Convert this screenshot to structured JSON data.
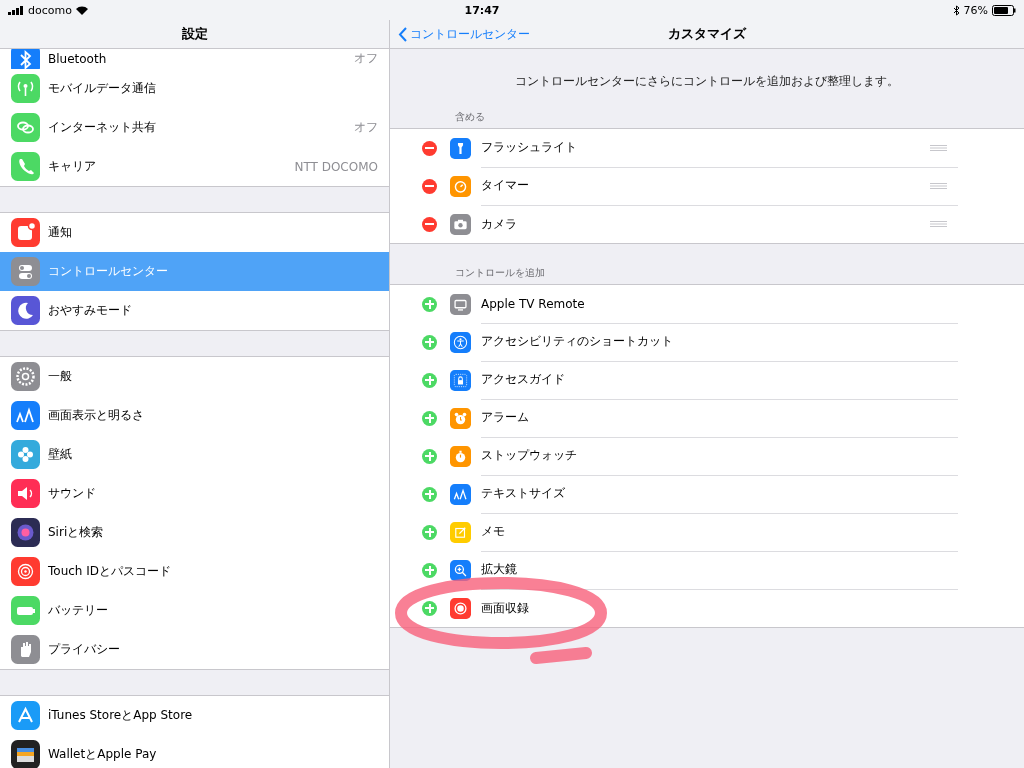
{
  "status_bar": {
    "carrier": "docomo",
    "time": "17:47",
    "battery": "76%"
  },
  "sidebar": {
    "title": "設定",
    "groups": [
      [
        {
          "label": "Bluetooth",
          "value": "オフ",
          "color": "#157efb",
          "selected": false
        },
        {
          "label": "モバイルデータ通信",
          "color": "#4cd964",
          "selected": false
        },
        {
          "label": "インターネット共有",
          "value": "オフ",
          "color": "#4cd964",
          "selected": false
        },
        {
          "label": "キャリア",
          "value": "NTT DOCOMO",
          "color": "#4cd964",
          "selected": false
        }
      ],
      [
        {
          "label": "通知",
          "color": "#ff3b30",
          "selected": false
        },
        {
          "label": "コントロールセンター",
          "color": "#8e8e93",
          "selected": true
        },
        {
          "label": "おやすみモード",
          "color": "#5856d6",
          "selected": false
        }
      ],
      [
        {
          "label": "一般",
          "color": "#8e8e93",
          "selected": false
        },
        {
          "label": "画面表示と明るさ",
          "color": "#157efb",
          "selected": false
        },
        {
          "label": "壁紙",
          "color": "#34aadc",
          "selected": false
        },
        {
          "label": "サウンド",
          "color": "#ff2d55",
          "selected": false
        },
        {
          "label": "Siriと検索",
          "color": "#2c2c54",
          "selected": false
        },
        {
          "label": "Touch IDとパスコード",
          "color": "#ff3b30",
          "selected": false
        },
        {
          "label": "バッテリー",
          "color": "#4cd964",
          "selected": false
        },
        {
          "label": "プライバシー",
          "color": "#8e8e93",
          "selected": false
        }
      ],
      [
        {
          "label": "iTunes StoreとApp Store",
          "color": "#1a9bf7",
          "selected": false
        },
        {
          "label": "WalletとApple Pay",
          "color": "#222222",
          "selected": false
        }
      ]
    ]
  },
  "detail": {
    "back": "コントロールセンター",
    "title": "カスタマイズ",
    "description": "コントロールセンターにさらにコントロールを追加および整理します。",
    "sections": [
      {
        "kind": "included",
        "header": "含める",
        "rows": [
          {
            "label": "フラッシュライト",
            "color": "#157efb"
          },
          {
            "label": "タイマー",
            "color": "#ff9500"
          },
          {
            "label": "カメラ",
            "color": "#8e8e93"
          }
        ]
      },
      {
        "kind": "available",
        "header": "コントロールを追加",
        "rows": [
          {
            "label": "Apple TV Remote",
            "color": "#8e8e93"
          },
          {
            "label": "アクセシビリティのショートカット",
            "color": "#157efb"
          },
          {
            "label": "アクセスガイド",
            "color": "#157efb"
          },
          {
            "label": "アラーム",
            "color": "#ff9500"
          },
          {
            "label": "ストップウォッチ",
            "color": "#ff9500"
          },
          {
            "label": "テキストサイズ",
            "color": "#157efb"
          },
          {
            "label": "メモ",
            "color": "#ffcc00"
          },
          {
            "label": "拡大鏡",
            "color": "#157efb"
          },
          {
            "label": "画面収録",
            "color": "#ff3b30"
          }
        ]
      }
    ]
  }
}
